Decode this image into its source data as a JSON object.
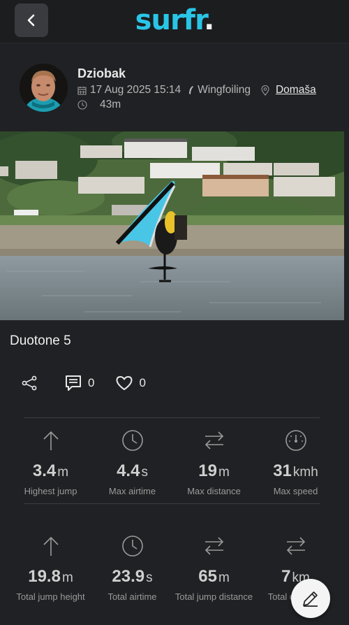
{
  "header": {
    "logo_main": "surfr",
    "logo_dot": "."
  },
  "session": {
    "user_name": "Dziobak",
    "date": "17 Aug 2025 15:14",
    "sport": "Wingfoiling",
    "location": "Domaša",
    "duration": "43m",
    "caption": "Duotone 5"
  },
  "actions": {
    "comments_count": "0",
    "likes_count": "0"
  },
  "stats_primary": [
    {
      "icon": "arrow-up-icon",
      "value": "3.4",
      "unit": "m",
      "label": "Highest jump"
    },
    {
      "icon": "clock-icon",
      "value": "4.4",
      "unit": "s",
      "label": "Max airtime"
    },
    {
      "icon": "arrows-swap-icon",
      "value": "19",
      "unit": "m",
      "label": "Max distance"
    },
    {
      "icon": "speedometer-icon",
      "value": "31",
      "unit": "kmh",
      "label": "Max speed"
    }
  ],
  "stats_total": [
    {
      "icon": "arrow-up-icon",
      "value": "19.8",
      "unit": "m",
      "label": "Total jump height"
    },
    {
      "icon": "clock-icon",
      "value": "23.9",
      "unit": "s",
      "label": "Total airtime"
    },
    {
      "icon": "arrows-swap-icon",
      "value": "65",
      "unit": "m",
      "label": "Total jump distance"
    },
    {
      "icon": "arrows-swap-icon",
      "value": "7",
      "unit": "km",
      "label": "Total distance"
    }
  ],
  "colors": {
    "brand": "#29c5e6",
    "background": "#202124",
    "fab": "#f4f4f4"
  }
}
